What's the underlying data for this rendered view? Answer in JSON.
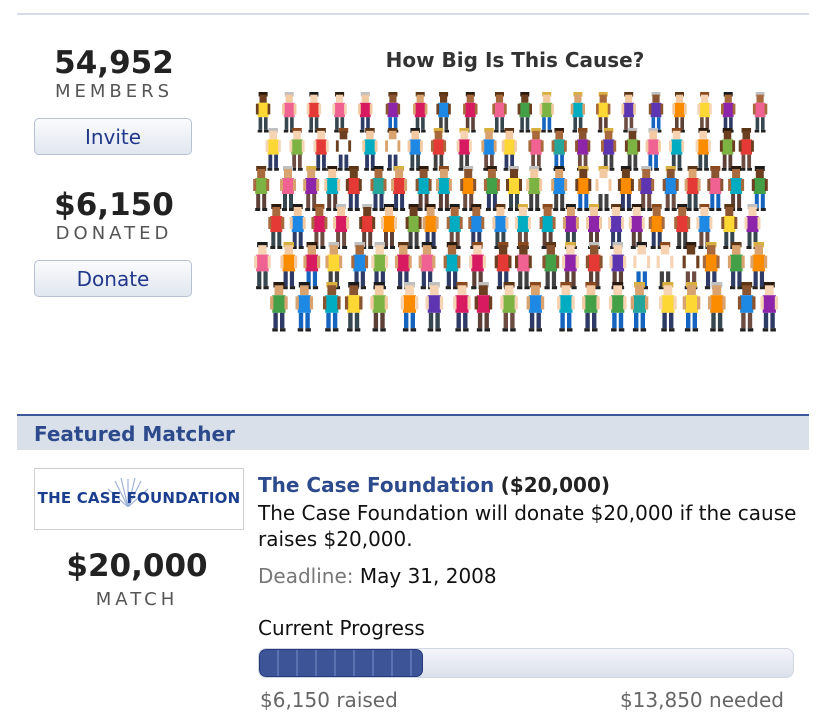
{
  "stats": {
    "members": {
      "value": "54,952",
      "label": "MEMBERS"
    },
    "donated": {
      "value": "$6,150",
      "label": "DONATED"
    }
  },
  "buttons": {
    "invite": "Invite",
    "donate": "Donate"
  },
  "cause": {
    "title": "How Big Is This Cause?"
  },
  "featured": {
    "section_title": "Featured Matcher",
    "logo_text": {
      "part1": "THE CASE",
      "part2": " FOUNDATION"
    },
    "match_value": "$20,000",
    "match_label": "MATCH",
    "name": "The Case Foundation",
    "amount": "($20,000)",
    "description": "The Case Foundation will donate $20,000 if the cause raises $20,000.",
    "deadline_label": "Deadline:",
    "deadline_value": "May 31, 2008"
  },
  "progress": {
    "title": "Current Progress",
    "raised_text": "$6,150 raised",
    "needed_text": "$13,850 needed",
    "fraction": 0.3075
  },
  "colors": {
    "accent": "#2d4a8c",
    "section_bg": "#d9e0ea",
    "progress_fill": "#3d5597"
  }
}
